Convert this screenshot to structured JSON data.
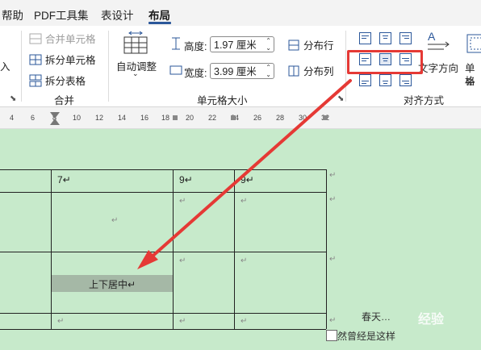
{
  "tabs": [
    {
      "label": "帮助",
      "active": false
    },
    {
      "label": "PDF工具集",
      "active": false
    },
    {
      "label": "表设计",
      "active": false
    },
    {
      "label": "布局",
      "active": true
    }
  ],
  "ribbon": {
    "left_partial_label": "入",
    "merge": {
      "merge_cells": "合并单元格",
      "split_cells": "拆分单元格",
      "split_table": "拆分表格",
      "group_label": "合并"
    },
    "cell_size": {
      "autofit": "自动调整",
      "height_label": "高度:",
      "height_value": "1.97 厘米",
      "width_label": "宽度:",
      "width_value": "3.99 厘米",
      "distribute_rows": "分布行",
      "distribute_cols": "分布列",
      "group_label": "单元格大小"
    },
    "alignment": {
      "text_direction": "文字方向",
      "cell_margin_partial_1": "单元",
      "cell_margin_partial_2": "格边",
      "group_label": "对齐方式",
      "selected": "align-center-middle"
    },
    "accent_color": "#2b579a",
    "highlight_color": "#e53935"
  },
  "ruler": {
    "ticks": [
      "4",
      "6",
      "8",
      "10",
      "12",
      "14",
      "16",
      "18",
      "20",
      "22",
      "24",
      "26",
      "28",
      "30",
      "32"
    ]
  },
  "document": {
    "background": "#c7eacb",
    "cells": {
      "r1c2": "7↵",
      "r1c3": "9↵",
      "r1c4": "9↵",
      "selected_cell_text": "上下居中↵"
    },
    "paragraph_mark": "↵",
    "text_right_1": "春天…",
    "text_right_2": "然曾经是这样",
    "watermark": "经验"
  }
}
